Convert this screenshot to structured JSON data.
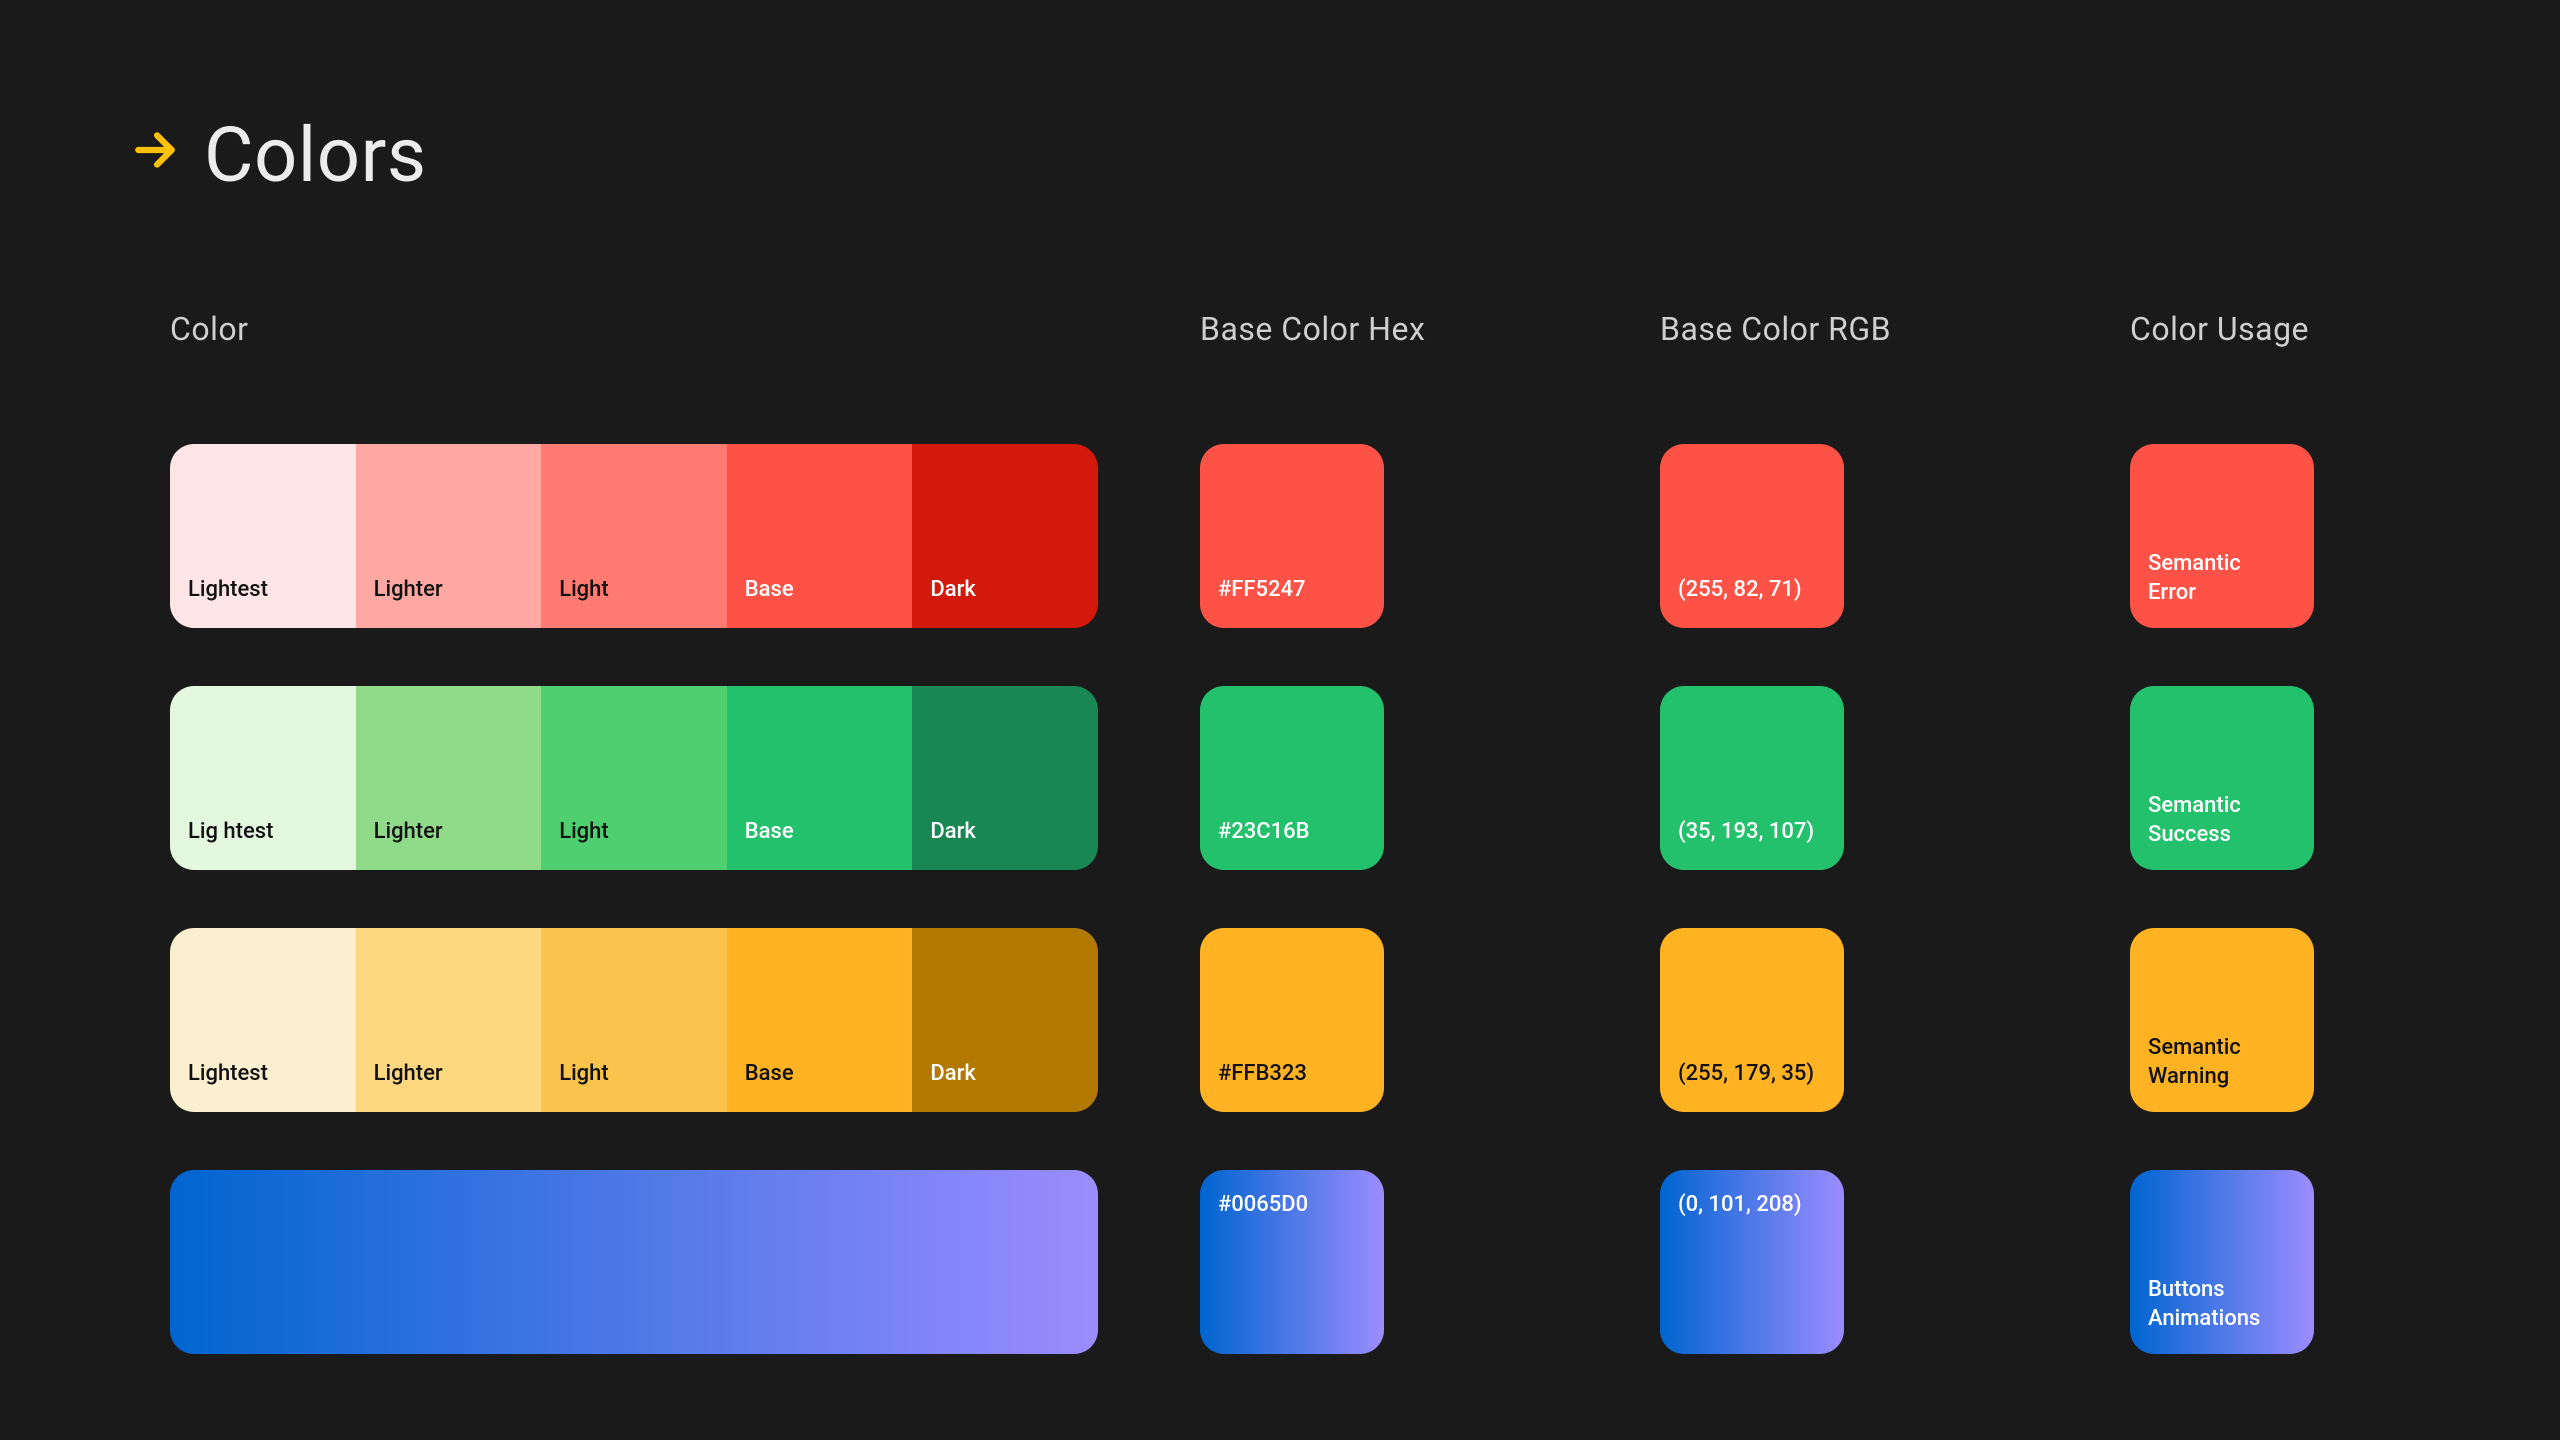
{
  "page_title": "Colors",
  "headers": {
    "color": "Color",
    "hex": "Base Color Hex",
    "rgb": "Base Color RGB",
    "usage": "Color Usage"
  },
  "shade_labels": {
    "lightest": "Lightest",
    "lighter": "Lighter",
    "light": "Light",
    "base": "Base",
    "dark": "Dark"
  },
  "rows": [
    {
      "name": "red",
      "shades": {
        "lightest": "#FFE5E5",
        "lighter": "#FFA8A3",
        "light": "#FF7A70",
        "base": "#FF5247",
        "dark": "#D3180C"
      },
      "hex": "#FF5247",
      "rgb": "(255, 82, 71)",
      "usage": "Semantic\nError",
      "shade_text_light": [
        "base",
        "dark"
      ]
    },
    {
      "name": "green",
      "shades": {
        "lightest": "#E4F8E0",
        "lighter": "#8FDB8A",
        "light": "#4FCF70",
        "base": "#23C16B",
        "dark": "#198754"
      },
      "hex": "#23C16B",
      "rgb": "(35, 193, 107)",
      "usage": "Semantic\nSuccess",
      "lightest_label": "Lig htest",
      "shade_text_light": [
        "base",
        "dark"
      ]
    },
    {
      "name": "yellow",
      "shades": {
        "lightest": "#FCEFD0",
        "lighter": "#FDD880",
        "light": "#FAC34C",
        "base": "#FFB323",
        "dark": "#B27900"
      },
      "hex": "#FFB323",
      "rgb": "(255, 179, 35)",
      "usage": "Semantic\nWarning",
      "usage_text_dark": true,
      "swatch_text_dark": true,
      "shade_text_light": [
        "dark"
      ]
    },
    {
      "name": "blue-gradient",
      "gradient_from": "#0065D0",
      "gradient_to": "#9C8CFF",
      "hex": "#0065D0",
      "rgb": "(0, 101, 208)",
      "usage": "Buttons\nAnimations",
      "hex_top": true,
      "rgb_top": true
    }
  ]
}
